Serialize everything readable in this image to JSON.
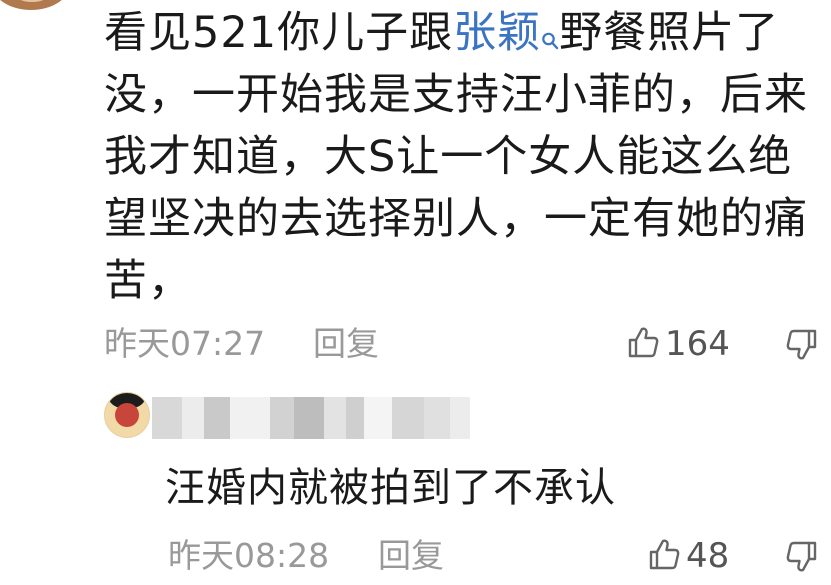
{
  "comment": {
    "text_before": "看见521你儿子跟",
    "link_name": "张颖",
    "text_after": "野餐照片了没，一开始我是支持汪小菲的，后来我才知道，大S让一个女人能这么绝望坚决的去选择别人，一定有她的痛苦，",
    "time": "昨天07:27",
    "reply_label": "回复",
    "like_count": "164"
  },
  "reply": {
    "text": "汪婚内就被拍到了不承认",
    "time": "昨天08:28",
    "reply_label": "回复",
    "like_count": "48"
  },
  "colors": {
    "text": "#1a1a1a",
    "link": "#3a74c2",
    "meta": "#999999"
  },
  "icons": [
    "search-icon",
    "thumbs-up-icon",
    "thumbs-down-icon"
  ]
}
